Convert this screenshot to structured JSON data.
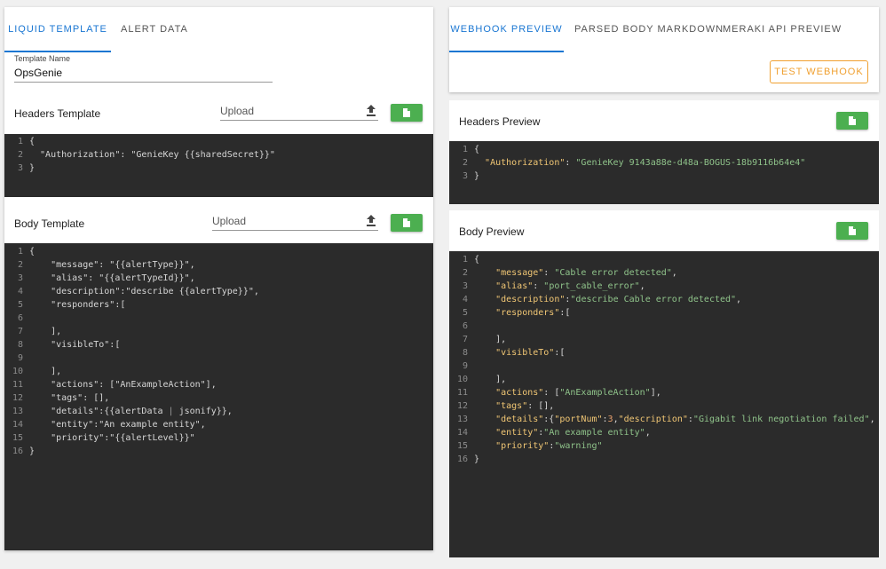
{
  "left": {
    "tabs": [
      "Liquid Template",
      "Alert Data"
    ],
    "template_name": {
      "label": "Template Name",
      "value": "OpsGenie"
    },
    "headers": {
      "title": "Headers Template",
      "upload_placeholder": "Upload",
      "code": [
        "{",
        "  \"Authorization\": \"GenieKey {{sharedSecret}}\"",
        "}"
      ]
    },
    "body": {
      "title": "Body Template",
      "upload_placeholder": "Upload",
      "code": [
        "{",
        "    \"message\": \"{{alertType}}\",",
        "    \"alias\": \"{{alertTypeId}}\",",
        "    \"description\":\"describe {{alertType}}\",",
        "    \"responders\":[",
        "",
        "    ],",
        "    \"visibleTo\":[",
        "",
        "    ],",
        "    \"actions\": [\"AnExampleAction\"],",
        "    \"tags\": [],",
        "    \"details\":{{alertData | jsonify}},",
        "    \"entity\":\"An example entity\",",
        "    \"priority\":\"{{alertLevel}}\"",
        "}"
      ]
    }
  },
  "right": {
    "tabs": [
      "Webhook Preview",
      "Parsed Body Markdown",
      "Meraki API Preview"
    ],
    "test_button": "Test Webhook",
    "headers_preview": {
      "title": "Headers Preview",
      "code": [
        "{",
        "  \"Authorization\": \"GenieKey 9143a88e-d48a-BOGUS-18b9116b64e4\"",
        "}"
      ]
    },
    "body_preview": {
      "title": "Body Preview",
      "code": [
        "{",
        "    \"message\": \"Cable error detected\",",
        "    \"alias\": \"port_cable_error\",",
        "    \"description\":\"describe Cable error detected\",",
        "    \"responders\":[",
        "",
        "    ],",
        "    \"visibleTo\":[",
        "",
        "    ],",
        "    \"actions\": [\"AnExampleAction\"],",
        "    \"tags\": [],",
        "    \"details\":{\"portNum\":3,\"description\":\"Gigabit link negotiation failed\",",
        "    \"entity\":\"An example entity\",",
        "    \"priority\":\"warning\"",
        "}"
      ]
    }
  },
  "icons": {
    "upload": "upload-icon",
    "file": "file-icon"
  },
  "colors": {
    "accent": "#1976d2",
    "success": "#4caf50",
    "warning": "#f0a030",
    "editor_bg": "#2b2b2b"
  }
}
